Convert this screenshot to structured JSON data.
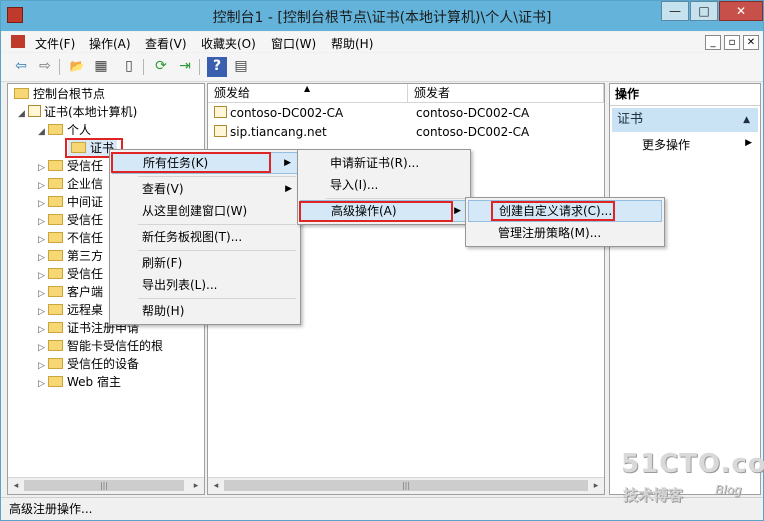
{
  "window": {
    "title": "控制台1 - [控制台根节点\\证书(本地计算机)\\个人\\证书]",
    "buttons": {
      "minimize": "—",
      "maximize": "□",
      "close": "✕"
    }
  },
  "menubar": [
    "文件(F)",
    "操作(A)",
    "查看(V)",
    "收藏夹(O)",
    "窗口(W)",
    "帮助(H)"
  ],
  "mdi_buttons": [
    "_",
    "▫",
    "✕"
  ],
  "toolbar": {
    "icons": [
      "back-icon",
      "forward-icon",
      "up-folder-icon",
      "show-hide-tree-icon",
      "properties-icon",
      "refresh-icon",
      "export-list-icon",
      "help-icon",
      "show-hide-action-pane-icon"
    ],
    "glyphs": {
      "back": "⇦",
      "forward": "⇨",
      "up": "📂",
      "tree": "▦",
      "props": "▯",
      "refresh": "⟳",
      "export": "⇥",
      "help": "?",
      "actionpane": "▤"
    }
  },
  "tree": {
    "root": "控制台根节点",
    "store": "证书(本地计算机)",
    "personal": "个人",
    "selected": "证书",
    "partial_items": [
      "受信任",
      "企业信",
      "中间证",
      "受信任",
      "不信任",
      "第三方",
      "受信任",
      "客户端",
      "远程桌"
    ],
    "full_items": [
      "证书注册申请",
      "智能卡受信任的根",
      "受信任的设备",
      "Web 宿主"
    ],
    "scroll_left": "◂",
    "scroll_right": "▸",
    "scroll_grip": "|||"
  },
  "list": {
    "columns": [
      "颁发给",
      "颁发者"
    ],
    "sort_arrow": "▲",
    "rows": [
      {
        "issued_to": "contoso-DC002-CA",
        "issued_by": "contoso-DC002-CA"
      },
      {
        "issued_to": "sip.tiancang.net",
        "issued_by": "contoso-DC002-CA"
      }
    ],
    "scroll_grip": "|||"
  },
  "context_menu": {
    "items": [
      "所有任务(K)",
      "查看(V)",
      "从这里创建窗口(W)",
      "新任务板视图(T)...",
      "刷新(F)",
      "导出列表(L)...",
      "帮助(H)"
    ],
    "submenu_arrow": "▶"
  },
  "all_tasks_menu": {
    "items": [
      "申请新证书(R)...",
      "导入(I)...",
      "高级操作(A)"
    ]
  },
  "advanced_menu": {
    "items": [
      "创建自定义请求(C)...",
      "管理注册策略(M)..."
    ]
  },
  "actions_pane": {
    "header": "操作",
    "section": "证书",
    "section_arrow": "▲",
    "more": "更多操作",
    "more_arrow": "▶"
  },
  "statusbar": {
    "text": "高级注册操作..."
  },
  "watermark": {
    "site": "51CTO.com",
    "blog_cn": "技术博客",
    "blog_en": "Blog"
  },
  "colors": {
    "titlebar": "#64b3db",
    "highlight": "#d5e8f7",
    "callout": "#e02424",
    "section": "#c9e3f4"
  }
}
